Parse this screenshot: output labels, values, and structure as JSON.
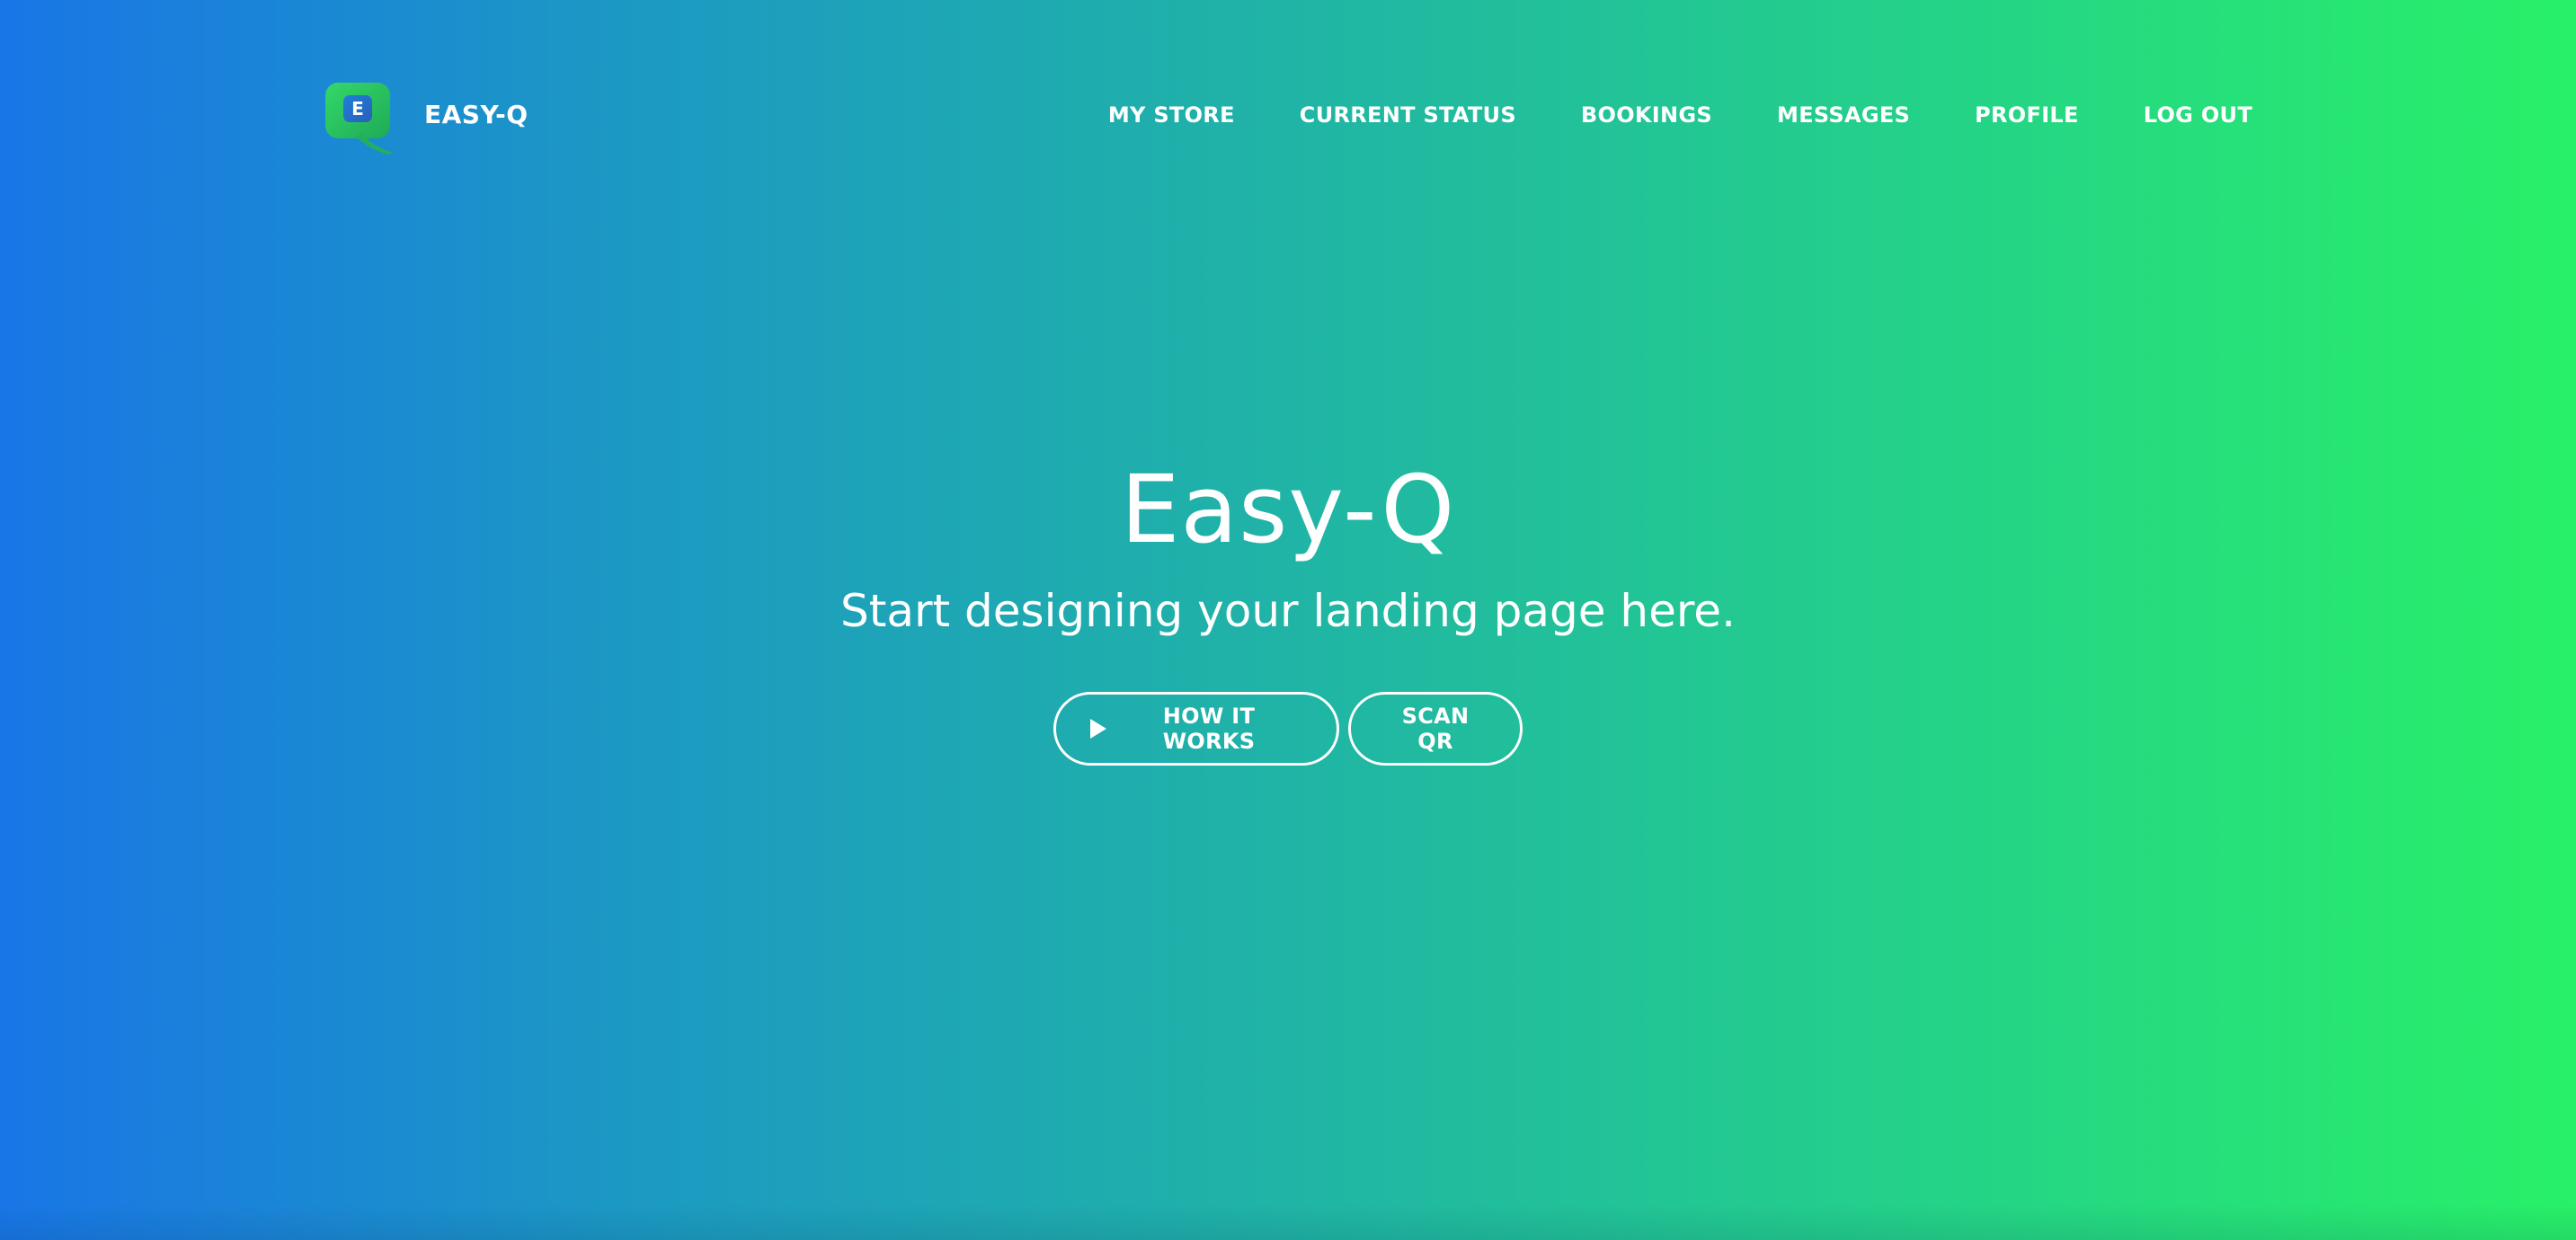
{
  "brand": {
    "name": "EASY-Q",
    "logo_letter": "E",
    "logo_icon": "easy-q-logo-icon"
  },
  "nav": {
    "items": [
      {
        "label": "MY STORE"
      },
      {
        "label": "CURRENT STATUS"
      },
      {
        "label": "BOOKINGS"
      },
      {
        "label": "MESSAGES"
      },
      {
        "label": "PROFILE"
      },
      {
        "label": "LOG OUT"
      }
    ]
  },
  "hero": {
    "title": "Easy-Q",
    "subtitle": "Start designing your landing page here.",
    "how_it_works_label": "HOW IT WORKS",
    "how_it_works_icon": "play-icon",
    "scan_qr_label": "SCAN QR"
  },
  "colors": {
    "gradient_start": "#1976e6",
    "gradient_end": "#28f068",
    "text": "#ffffff",
    "logo_green": "#2ecc71"
  }
}
